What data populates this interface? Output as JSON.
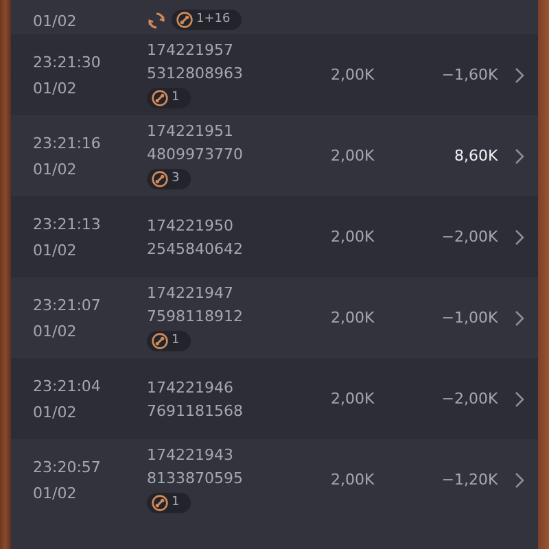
{
  "top_row": {
    "date": "01/02",
    "spin_badge": true,
    "badge_count": "1+16"
  },
  "rows": [
    {
      "time": "23:21:30",
      "date": "01/02",
      "round_id": "174221957",
      "ticket_id": "5312808963",
      "badge_count": "1",
      "stake": "2,00K",
      "result": "−1,60K",
      "highlight": false
    },
    {
      "time": "23:21:16",
      "date": "01/02",
      "round_id": "174221951",
      "ticket_id": "4809973770",
      "badge_count": "3",
      "stake": "2,00K",
      "result": "8,60K",
      "highlight": true
    },
    {
      "time": "23:21:13",
      "date": "01/02",
      "round_id": "174221950",
      "ticket_id": "2545840642",
      "stake": "2,00K",
      "result": "−2,00K",
      "highlight": false
    },
    {
      "time": "23:21:07",
      "date": "01/02",
      "round_id": "174221947",
      "ticket_id": "7598118912",
      "badge_count": "1",
      "stake": "2,00K",
      "result": "−1,00K",
      "highlight": false
    },
    {
      "time": "23:21:04",
      "date": "01/02",
      "round_id": "174221946",
      "ticket_id": "7691181568",
      "stake": "2,00K",
      "result": "−2,00K",
      "highlight": false
    },
    {
      "time": "23:20:57",
      "date": "01/02",
      "round_id": "174221943",
      "ticket_id": "8133870595",
      "badge_count": "1",
      "stake": "2,00K",
      "result": "−1,20K",
      "highlight": false
    }
  ]
}
